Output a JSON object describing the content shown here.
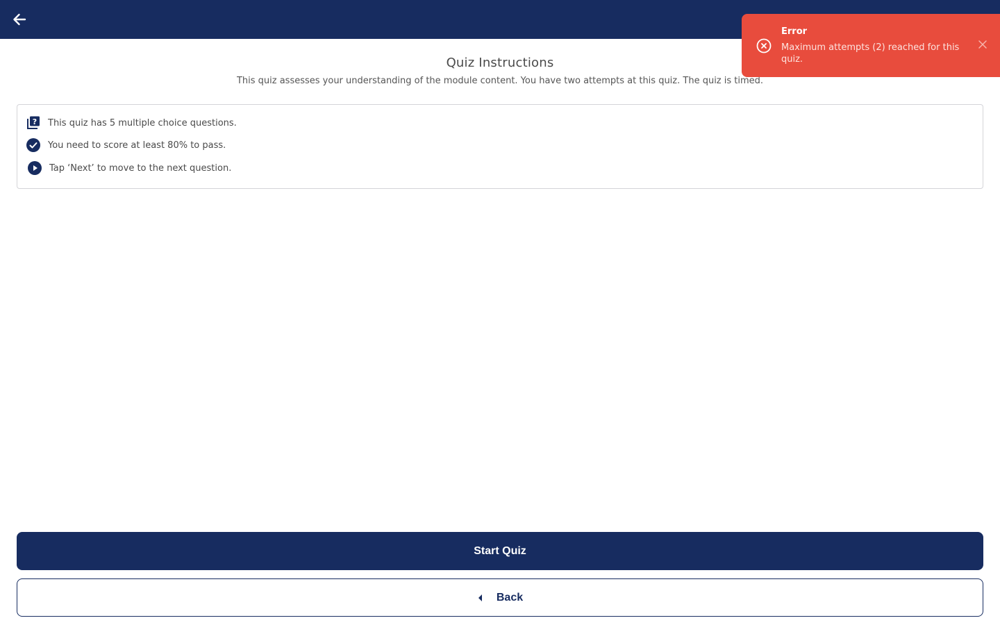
{
  "header": {
    "back_icon": "arrow-left-icon",
    "bg_color": "#172c60"
  },
  "instructions": {
    "title": "Quiz Instructions",
    "subtitle": "This quiz assesses your understanding of the module content. You have two attempts at this quiz. The quiz is timed.",
    "items": [
      {
        "icon": "quiz-icon",
        "text": "This quiz has 5 multiple choice questions."
      },
      {
        "icon": "check-circle-icon",
        "text": "You need to score at least 80% to pass."
      },
      {
        "icon": "play-circle-icon",
        "text": "Tap ‘Next’ to move to the next question."
      }
    ]
  },
  "actions": {
    "start_label": "Start Quiz",
    "back_label": "Back"
  },
  "toast": {
    "title": "Error",
    "message": "Maximum attempts (2) reached for this quiz.",
    "icon": "error-circle-icon",
    "close_icon": "close-icon",
    "bg_color": "#e84c3d"
  },
  "colors": {
    "primary": "#172c60",
    "error": "#e84c3d"
  }
}
